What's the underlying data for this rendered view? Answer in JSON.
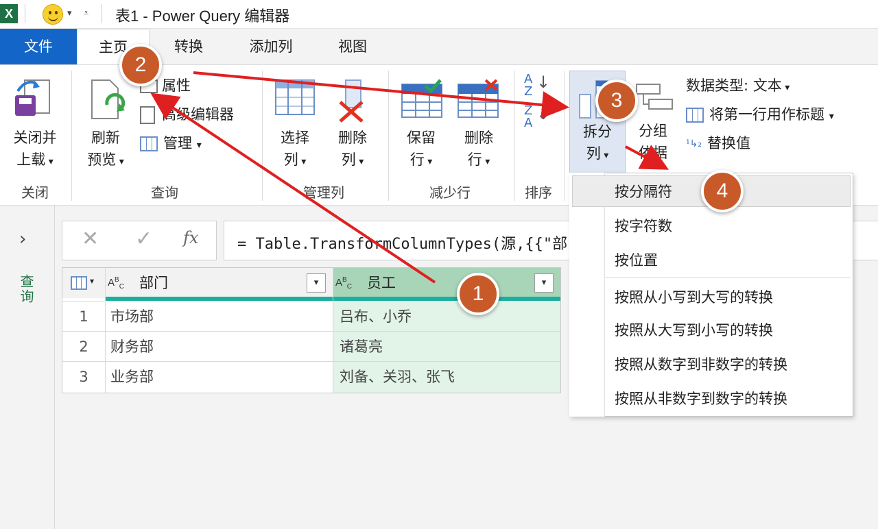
{
  "window": {
    "app_icon": "excel-logo",
    "title": "表1 - Power Query 编辑器"
  },
  "tabs": {
    "file": "文件",
    "home": "主页",
    "transform": "转换",
    "add_column": "添加列",
    "view": "视图"
  },
  "ribbon": {
    "close_group": {
      "label": "关闭",
      "close_load_line1": "关闭并",
      "close_load_line2": "上载"
    },
    "query_group": {
      "label": "查询",
      "refresh_line1": "刷新",
      "refresh_line2": "预览",
      "properties": "属性",
      "advanced_editor": "高级编辑器",
      "manage": "管理"
    },
    "manage_cols_group": {
      "label": "管理列",
      "choose_line1": "选择",
      "choose_line2": "列",
      "remove_line1": "删除",
      "remove_line2": "列"
    },
    "reduce_rows_group": {
      "label": "减少行",
      "keep_line1": "保留",
      "keep_line2": "行",
      "remove_line1": "删除",
      "remove_line2": "行"
    },
    "sort_group": {
      "label": "排序"
    },
    "transform_group": {
      "split_line1": "拆分",
      "split_line2": "列",
      "group_line1": "分组",
      "group_line2": "依据",
      "data_type": "数据类型: 文本",
      "first_row_header": "将第一行用作标题",
      "replace_values": "替换值"
    }
  },
  "side_pane": {
    "label": "查询"
  },
  "formula_bar": {
    "fx": "fx",
    "formula": "= Table.TransformColumnTypes(源,{{\"部"
  },
  "table": {
    "columns": [
      {
        "type": "ABC",
        "name": "部门"
      },
      {
        "type": "ABC",
        "name": "员工"
      }
    ],
    "rows": [
      {
        "num": "1",
        "dept": "市场部",
        "staff": "吕布、小乔"
      },
      {
        "num": "2",
        "dept": "财务部",
        "staff": "诸葛亮"
      },
      {
        "num": "3",
        "dept": "业务部",
        "staff": "刘备、关羽、张飞"
      }
    ]
  },
  "split_menu": {
    "items": [
      "按分隔符",
      "按字符数",
      "按位置",
      "按照从小写到大写的转换",
      "按照从大写到小写的转换",
      "按照从数字到非数字的转换",
      "按照从非数字到数字的转换"
    ]
  },
  "callouts": [
    "1",
    "2",
    "3",
    "4"
  ],
  "colors": {
    "accent_blue": "#1366c8",
    "excel_green": "#217346",
    "callout": "#c85a2a",
    "arrow": "#e02020"
  }
}
